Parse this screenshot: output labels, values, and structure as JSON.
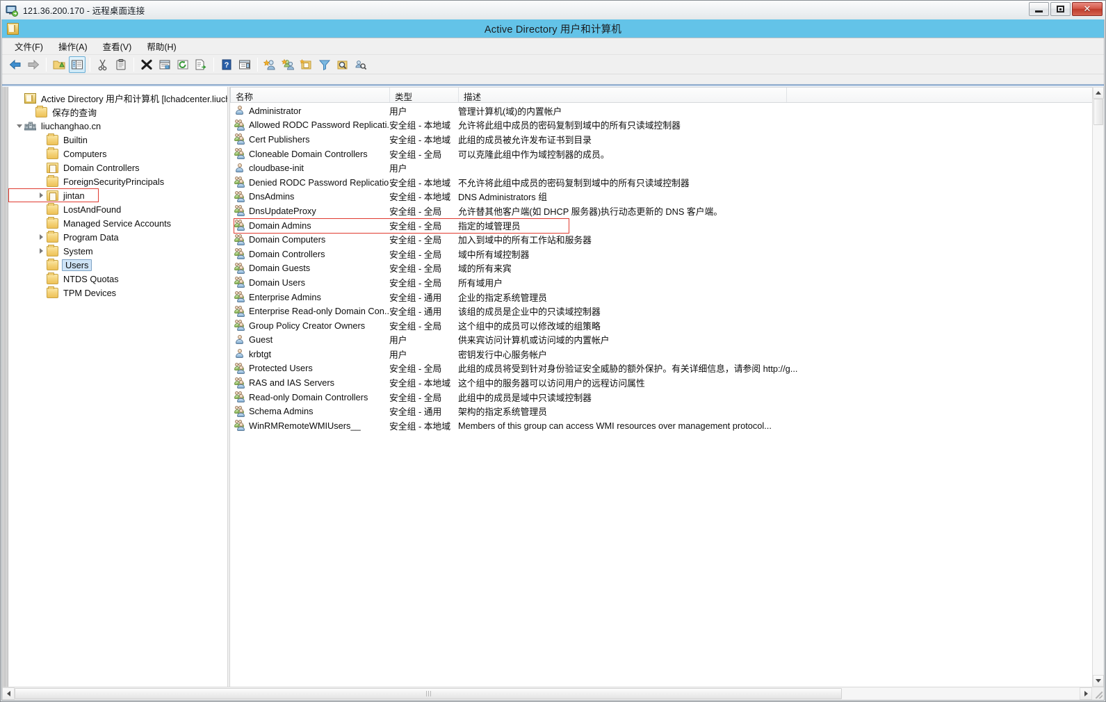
{
  "rdp": {
    "title": "121.36.200.170 - 远程桌面连接",
    "icon": "remote-desktop-icon",
    "buttons": {
      "minimize": "–",
      "maximize": "□",
      "close": "✕"
    }
  },
  "mmc": {
    "caption_title": "Active Directory 用户和计算机",
    "caption_icon": "console-icon",
    "caption_color": "#63c3e8",
    "menu": [
      {
        "label": "文件(F)",
        "name": "menu-file"
      },
      {
        "label": "操作(A)",
        "name": "menu-action"
      },
      {
        "label": "查看(V)",
        "name": "menu-view"
      },
      {
        "label": "帮助(H)",
        "name": "menu-help"
      }
    ],
    "toolbar": [
      {
        "name": "back-button",
        "icon": "arrow-left-icon",
        "type": "arrow-left"
      },
      {
        "name": "forward-button",
        "icon": "arrow-right-icon",
        "type": "arrow-right"
      },
      {
        "name": "sep1",
        "type": "sep"
      },
      {
        "name": "up-one-level-button",
        "icon": "folder-up-icon",
        "type": "folder"
      },
      {
        "name": "show-hide-tree-button",
        "icon": "console-tree-icon",
        "type": "tree",
        "pressed": true
      },
      {
        "name": "sep2",
        "type": "sep"
      },
      {
        "name": "cut-button",
        "icon": "scissors-icon",
        "type": "scissors"
      },
      {
        "name": "copy-button",
        "icon": "clipboard-icon",
        "type": "clipboard"
      },
      {
        "name": "sep3",
        "type": "sep"
      },
      {
        "name": "delete-button",
        "icon": "delete-x-icon",
        "type": "xmark"
      },
      {
        "name": "properties-button",
        "icon": "properties-icon",
        "type": "props"
      },
      {
        "name": "refresh-button",
        "icon": "refresh-icon",
        "type": "refresh"
      },
      {
        "name": "export-list-button",
        "icon": "export-list-icon",
        "type": "export"
      },
      {
        "name": "sep4",
        "type": "sep"
      },
      {
        "name": "help-button",
        "icon": "question-mark-icon",
        "type": "help"
      },
      {
        "name": "show-action-pane-button",
        "icon": "action-pane-icon",
        "type": "pane"
      },
      {
        "name": "sep5",
        "type": "sep"
      },
      {
        "name": "new-user-button",
        "icon": "new-user-icon",
        "type": "newuser"
      },
      {
        "name": "new-group-button",
        "icon": "new-group-icon",
        "type": "newgroup"
      },
      {
        "name": "new-ou-button",
        "icon": "new-ou-icon",
        "type": "newou"
      },
      {
        "name": "filter-button",
        "icon": "funnel-filter-icon",
        "type": "funnel"
      },
      {
        "name": "find-button",
        "icon": "magnifier-search-icon",
        "type": "find"
      },
      {
        "name": "saved-query-button",
        "icon": "saved-query-icon",
        "type": "query"
      }
    ]
  },
  "tree": {
    "items": [
      {
        "label": "Active Directory 用户和计算机 [lchadcenter.liuchang",
        "indent": 0,
        "icon": "console-icon",
        "expander": "none",
        "selected": false,
        "redbox": false
      },
      {
        "label": "保存的查询",
        "indent": 1,
        "icon": "folder-icon",
        "expander": "none",
        "selected": false,
        "redbox": false
      },
      {
        "label": "liuchanghao.cn",
        "indent": 0,
        "icon": "domain-icon",
        "expander": "open",
        "selected": false,
        "redbox": false
      },
      {
        "label": "Builtin",
        "indent": 2,
        "icon": "folder-icon",
        "expander": "none",
        "selected": false,
        "redbox": false
      },
      {
        "label": "Computers",
        "indent": 2,
        "icon": "folder-icon",
        "expander": "none",
        "selected": false,
        "redbox": false
      },
      {
        "label": "Domain Controllers",
        "indent": 2,
        "icon": "ou-icon",
        "expander": "none",
        "selected": false,
        "redbox": false
      },
      {
        "label": "ForeignSecurityPrincipals",
        "indent": 2,
        "icon": "folder-icon",
        "expander": "none",
        "selected": false,
        "redbox": false
      },
      {
        "label": "jintan",
        "indent": 2,
        "icon": "ou-icon",
        "expander": "closed",
        "selected": false,
        "redbox": true
      },
      {
        "label": "LostAndFound",
        "indent": 2,
        "icon": "folder-icon",
        "expander": "none",
        "selected": false,
        "redbox": false
      },
      {
        "label": "Managed Service Accounts",
        "indent": 2,
        "icon": "folder-icon",
        "expander": "none",
        "selected": false,
        "redbox": false
      },
      {
        "label": "Program Data",
        "indent": 2,
        "icon": "folder-icon",
        "expander": "closed",
        "selected": false,
        "redbox": false
      },
      {
        "label": "System",
        "indent": 2,
        "icon": "folder-icon",
        "expander": "closed",
        "selected": false,
        "redbox": false
      },
      {
        "label": "Users",
        "indent": 2,
        "icon": "folder-icon",
        "expander": "none",
        "selected": true,
        "redbox": false
      },
      {
        "label": "NTDS Quotas",
        "indent": 2,
        "icon": "folder-icon",
        "expander": "none",
        "selected": false,
        "redbox": false
      },
      {
        "label": "TPM Devices",
        "indent": 2,
        "icon": "folder-icon",
        "expander": "none",
        "selected": false,
        "redbox": false
      }
    ]
  },
  "list": {
    "columns": [
      {
        "label": "名称",
        "name": "column-header-name"
      },
      {
        "label": "类型",
        "name": "column-header-type"
      },
      {
        "label": "描述",
        "name": "column-header-description"
      }
    ],
    "rows": [
      {
        "name": "Administrator",
        "type": "用户",
        "description": "管理计算机(域)的内置帐户",
        "icon": "user-icon",
        "redbox": false
      },
      {
        "name": "Allowed RODC Password Replicati...",
        "type": "安全组 - 本地域",
        "description": "允许将此组中成员的密码复制到域中的所有只读域控制器",
        "icon": "group-icon",
        "redbox": false
      },
      {
        "name": "Cert Publishers",
        "type": "安全组 - 本地域",
        "description": "此组的成员被允许发布证书到目录",
        "icon": "group-icon",
        "redbox": false
      },
      {
        "name": "Cloneable Domain Controllers",
        "type": "安全组 - 全局",
        "description": "可以克隆此组中作为域控制器的成员。",
        "icon": "group-icon",
        "redbox": false
      },
      {
        "name": "cloudbase-init",
        "type": "用户",
        "description": "",
        "icon": "user-icon",
        "redbox": false
      },
      {
        "name": "Denied RODC Password Replicatio...",
        "type": "安全组 - 本地域",
        "description": "不允许将此组中成员的密码复制到域中的所有只读域控制器",
        "icon": "group-icon",
        "redbox": false
      },
      {
        "name": "DnsAdmins",
        "type": "安全组 - 本地域",
        "description": "DNS Administrators 组",
        "icon": "group-icon",
        "redbox": false
      },
      {
        "name": "DnsUpdateProxy",
        "type": "安全组 - 全局",
        "description": "允许替其他客户端(如 DHCP 服务器)执行动态更新的 DNS 客户端。",
        "icon": "group-icon",
        "redbox": false
      },
      {
        "name": "Domain Admins",
        "type": "安全组 - 全局",
        "description": "指定的域管理员",
        "icon": "group-icon",
        "redbox": true
      },
      {
        "name": "Domain Computers",
        "type": "安全组 - 全局",
        "description": "加入到域中的所有工作站和服务器",
        "icon": "group-icon",
        "redbox": false
      },
      {
        "name": "Domain Controllers",
        "type": "安全组 - 全局",
        "description": "域中所有域控制器",
        "icon": "group-icon",
        "redbox": false
      },
      {
        "name": "Domain Guests",
        "type": "安全组 - 全局",
        "description": "域的所有来宾",
        "icon": "group-icon",
        "redbox": false
      },
      {
        "name": "Domain Users",
        "type": "安全组 - 全局",
        "description": "所有域用户",
        "icon": "group-icon",
        "redbox": false
      },
      {
        "name": "Enterprise Admins",
        "type": "安全组 - 通用",
        "description": "企业的指定系统管理员",
        "icon": "group-icon",
        "redbox": false
      },
      {
        "name": "Enterprise Read-only Domain Con...",
        "type": "安全组 - 通用",
        "description": "该组的成员是企业中的只读域控制器",
        "icon": "group-icon",
        "redbox": false
      },
      {
        "name": "Group Policy Creator Owners",
        "type": "安全组 - 全局",
        "description": "这个组中的成员可以修改域的组策略",
        "icon": "group-icon",
        "redbox": false
      },
      {
        "name": "Guest",
        "type": "用户",
        "description": "供来宾访问计算机或访问域的内置帐户",
        "icon": "user-icon",
        "redbox": false
      },
      {
        "name": "krbtgt",
        "type": "用户",
        "description": "密钥发行中心服务帐户",
        "icon": "user-icon",
        "redbox": false
      },
      {
        "name": "Protected Users",
        "type": "安全组 - 全局",
        "description": "此组的成员将受到针对身份验证安全威胁的额外保护。有关详细信息，请参阅 http://g...",
        "icon": "group-icon",
        "redbox": false
      },
      {
        "name": "RAS and IAS Servers",
        "type": "安全组 - 本地域",
        "description": "这个组中的服务器可以访问用户的远程访问属性",
        "icon": "group-icon",
        "redbox": false
      },
      {
        "name": "Read-only Domain Controllers",
        "type": "安全组 - 全局",
        "description": "此组中的成员是域中只读域控制器",
        "icon": "group-icon",
        "redbox": false
      },
      {
        "name": "Schema Admins",
        "type": "安全组 - 通用",
        "description": "架构的指定系统管理员",
        "icon": "group-icon",
        "redbox": false
      },
      {
        "name": "WinRMRemoteWMIUsers__",
        "type": "安全组 - 本地域",
        "description": "Members of this group can access WMI resources over management protocol...",
        "icon": "group-icon",
        "redbox": false
      }
    ]
  },
  "scroll": {
    "vertical_thumb_name": "vertical-scrollbar-thumb",
    "horizontal_thumb_name": "horizontal-scrollbar-thumb"
  },
  "colors": {
    "accent": "#63c3e8",
    "highlight_box": "#e03a2f",
    "selection": "#cfe4f7"
  }
}
